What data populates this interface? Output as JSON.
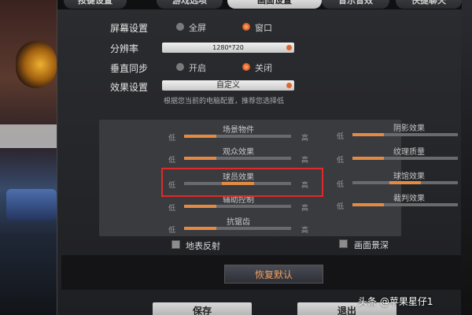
{
  "tabs": [
    {
      "label": "按键设置"
    },
    {
      "label": "游戏选项"
    },
    {
      "label": "画面设置"
    },
    {
      "label": "音乐音效"
    },
    {
      "label": "快捷聊天"
    }
  ],
  "screen": {
    "label": "屏幕设置",
    "options": [
      "全屏",
      "窗口"
    ],
    "selected": "窗口"
  },
  "resolution": {
    "label": "分辨率",
    "value": "1280*720"
  },
  "vsync": {
    "label": "垂直同步",
    "options": [
      "开启",
      "关闭"
    ],
    "selected": "关闭"
  },
  "effects": {
    "label": "效果设置",
    "value": "自定义",
    "hint": "根据您当前的电脑配置，推荐您选择低"
  },
  "sliders": {
    "low": "低",
    "high": "高",
    "left": [
      {
        "label": "场景物件",
        "level_fraction": 0.13
      },
      {
        "label": "观众效果",
        "level_fraction": 0.13
      },
      {
        "label": "球员效果",
        "level_fraction": 0.5
      },
      {
        "label": "辅助控制",
        "level_fraction": 0.13
      },
      {
        "label": "抗锯齿",
        "level_fraction": 0.13
      }
    ],
    "right": [
      {
        "label": "阴影效果",
        "level_fraction": 0.13
      },
      {
        "label": "纹理质量",
        "level_fraction": 0.13
      },
      {
        "label": "球馆效果",
        "level_fraction": 0.5
      },
      {
        "label": "裁判效果",
        "level_fraction": 0.13
      }
    ]
  },
  "checkboxes": [
    {
      "label": "地表反射",
      "checked": false
    },
    {
      "label": "画面景深",
      "checked": false
    }
  ],
  "buttons": {
    "reset": "恢复默认",
    "save": "保存",
    "exit": "退出"
  },
  "watermark": "头条 @苹果星仔1",
  "colors": {
    "accent": "#e38a45",
    "highlight_box": "#e02a2a"
  }
}
